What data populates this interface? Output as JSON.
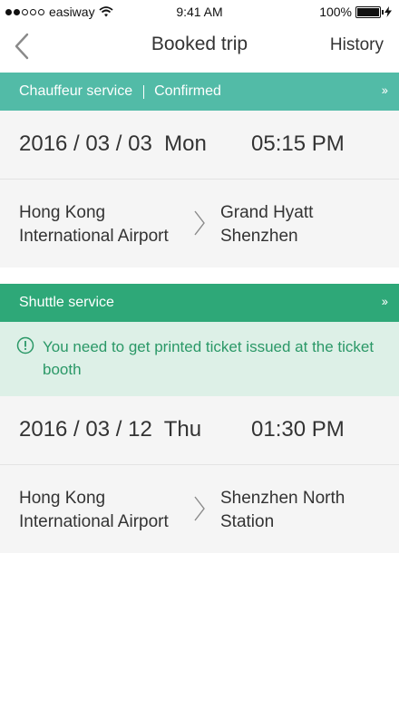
{
  "status_bar": {
    "carrier": "easiway",
    "time": "9:41 AM",
    "battery": "100%"
  },
  "nav": {
    "title": "Booked trip",
    "history": "History"
  },
  "trips": [
    {
      "service": "Chauffeur service",
      "status": "Confirmed",
      "chevron": "››",
      "date": "2016 / 03 / 03  Mon",
      "time": "05:15 PM",
      "origin": "Hong Kong International Airport",
      "destination": "Grand Hyatt Shenzhen"
    },
    {
      "service": "Shuttle service",
      "chevron": "››",
      "notice": "You need to get printed ticket issued at the ticket booth",
      "date": "2016 / 03 / 12  Thu",
      "time": "01:30 PM",
      "origin": "Hong Kong International Airport",
      "destination": "Shenzhen North Station"
    }
  ],
  "colors": {
    "chauffeur_header": "#52bba7",
    "shuttle_header": "#2ea878",
    "notice_bg": "#ddf0e7",
    "notice_text": "#2a9867"
  }
}
